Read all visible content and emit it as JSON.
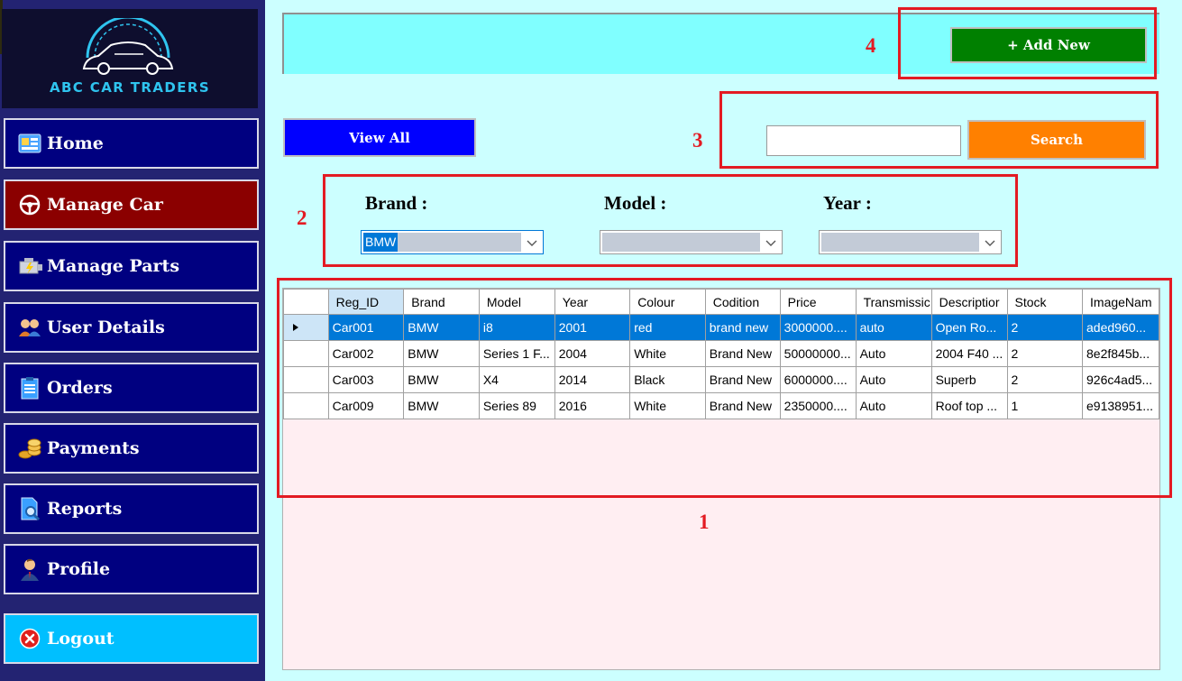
{
  "app": {
    "logo_text": "ABC CAR TRADERS"
  },
  "sidebar": {
    "items": [
      {
        "label": "Home",
        "icon": "dashboard-icon"
      },
      {
        "label": "Manage Car",
        "icon": "steering-wheel-icon",
        "active": true
      },
      {
        "label": "Manage Parts",
        "icon": "engine-icon"
      },
      {
        "label": "User Details",
        "icon": "users-icon"
      },
      {
        "label": "Orders",
        "icon": "clipboard-icon"
      },
      {
        "label": "Payments",
        "icon": "coins-icon"
      },
      {
        "label": "Reports",
        "icon": "report-search-icon"
      },
      {
        "label": "Profile",
        "icon": "person-icon"
      }
    ],
    "logout_label": "Logout"
  },
  "toolbar": {
    "add_new_label": "+ Add New",
    "view_all_label": "View All",
    "search_label": "Search",
    "search_value": ""
  },
  "filters": {
    "brand_label": "Brand :",
    "brand_value": "BMW",
    "model_label": "Model :",
    "model_value": "",
    "year_label": "Year :",
    "year_value": ""
  },
  "grid": {
    "columns": [
      "Reg_ID",
      "Brand",
      "Model",
      "Year",
      "Colour",
      "Codition",
      "Price",
      "Transmissic",
      "Descriptior",
      "Stock",
      "ImageNam"
    ],
    "rows": [
      [
        "Car001",
        "BMW",
        "i8",
        "2001",
        "red",
        "brand new",
        "3000000....",
        "auto",
        "Open Ro...",
        "2",
        "aded960..."
      ],
      [
        "Car002",
        "BMW",
        "Series 1 F...",
        "2004",
        "White",
        "Brand New",
        "50000000...",
        "Auto",
        "2004 F40 ...",
        "2",
        "8e2f845b..."
      ],
      [
        "Car003",
        "BMW",
        "X4",
        "2014",
        "Black",
        "Brand New",
        "6000000....",
        "Auto",
        "Superb",
        "2",
        "926c4ad5..."
      ],
      [
        "Car009",
        "BMW",
        "Series 89",
        "2016",
        "White",
        "Brand New",
        "2350000....",
        "Auto",
        "Roof top ...",
        "1",
        "e9138951..."
      ]
    ],
    "selected_row": 0
  },
  "annotations": {
    "labels": [
      "1",
      "2",
      "3",
      "4"
    ],
    "color": "#e31b23"
  },
  "colors": {
    "sidebar_bg": "#232372",
    "nav_btn_bg": "#000080",
    "active_nav_bg": "#8b0000",
    "logout_bg": "#00bfff",
    "add_new_bg": "#008000",
    "view_all_bg": "#0000ff",
    "search_bg": "#ff8000",
    "selection": "#0078d7"
  }
}
